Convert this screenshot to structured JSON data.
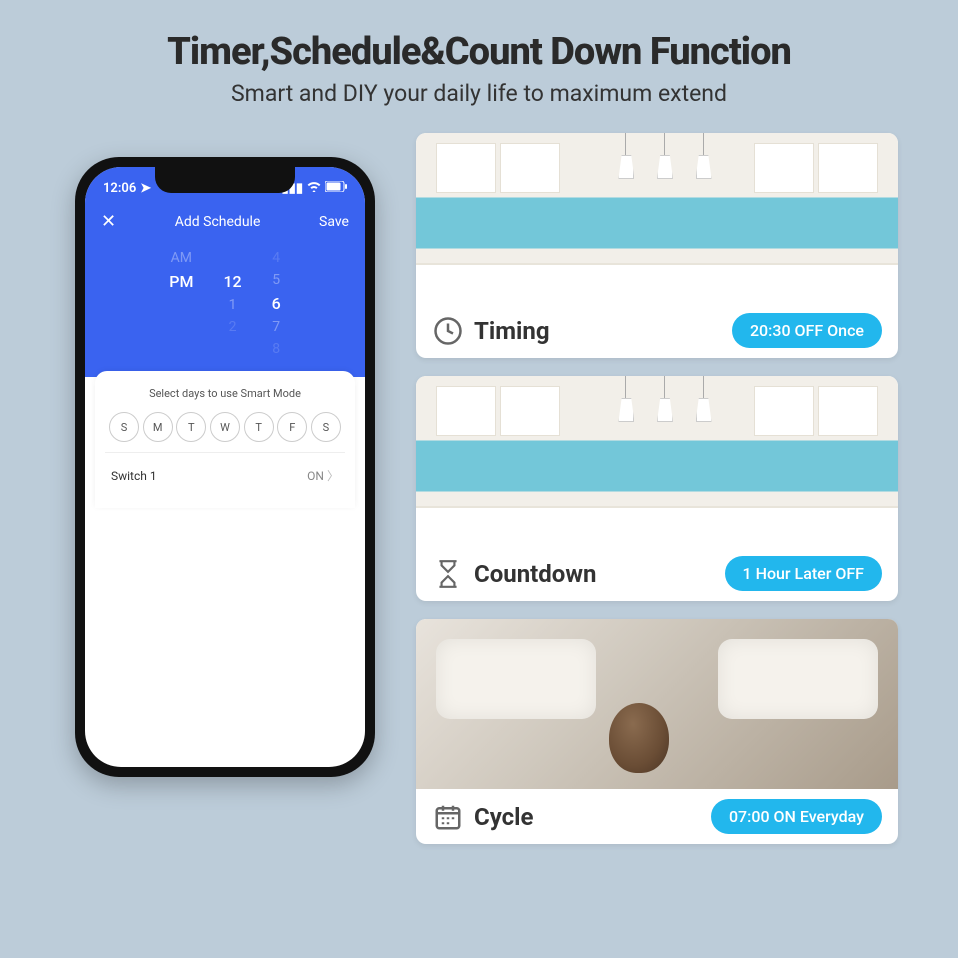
{
  "hero": {
    "title": "Timer,Schedule&Count Down Function",
    "subtitle": "Smart and DIY your daily life to maximum extend"
  },
  "phone": {
    "status_time": "12:06",
    "header": {
      "close": "✕",
      "title": "Add Schedule",
      "save": "Save"
    },
    "picker": {
      "ampm": [
        "AM",
        "PM"
      ],
      "ampm_selected": "PM",
      "hours": [
        "",
        "12",
        "1",
        "2"
      ],
      "hours_selected": "12",
      "minutes": [
        "4",
        "5",
        "6",
        "7",
        "8"
      ],
      "minutes_selected": "6"
    },
    "panel_title": "Select days to use Smart Mode",
    "days": [
      "S",
      "M",
      "T",
      "W",
      "T",
      "F",
      "S"
    ],
    "row": {
      "label": "Switch 1",
      "state": "ON"
    }
  },
  "cards": [
    {
      "icon": "clock",
      "title": "Timing",
      "pill": "20:30 OFF Once",
      "img": "kitchen"
    },
    {
      "icon": "hourglass",
      "title": "Countdown",
      "pill": "1 Hour Later OFF",
      "img": "kitchen"
    },
    {
      "icon": "calendar",
      "title": "Cycle",
      "pill": "07:00 ON Everyday",
      "img": "sleep"
    }
  ]
}
